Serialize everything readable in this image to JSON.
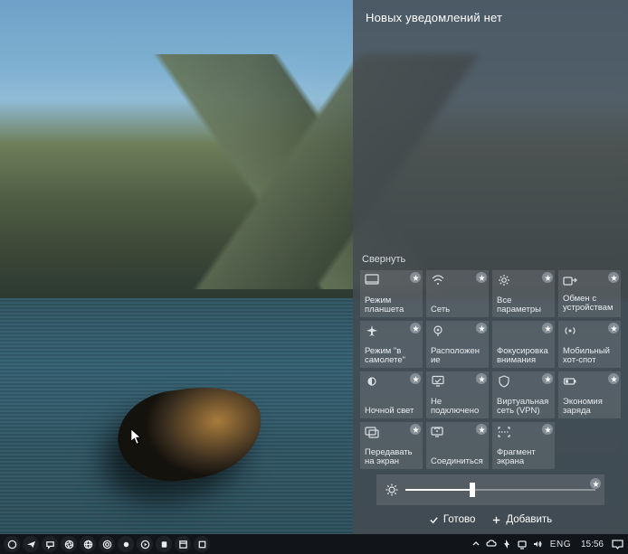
{
  "panel": {
    "title": "Новых уведомлений нет",
    "collapse_label": "Свернуть",
    "tiles": [
      {
        "id": "tablet-mode",
        "label": "Режим планшета",
        "icon": "tablet"
      },
      {
        "id": "network",
        "label": "Сеть",
        "icon": "wifi"
      },
      {
        "id": "settings",
        "label": "Все параметры",
        "icon": "gear"
      },
      {
        "id": "share",
        "label": "Обмен с устройствами",
        "icon": "share"
      },
      {
        "id": "airplane",
        "label": "Режим \"в самолете\"",
        "icon": "airplane"
      },
      {
        "id": "location",
        "label": "Расположение",
        "icon": "location"
      },
      {
        "id": "focus-assist",
        "label": "Фокусировка внимания",
        "icon": "moon"
      },
      {
        "id": "hotspot",
        "label": "Мобильный хот-спот",
        "icon": "hotspot"
      },
      {
        "id": "night-light",
        "label": "Ночной свет",
        "icon": "nightlight"
      },
      {
        "id": "vpn-status",
        "label": "Не подключено",
        "icon": "vpn"
      },
      {
        "id": "vpn",
        "label": "Виртуальная сеть (VPN)",
        "icon": "shield"
      },
      {
        "id": "battery-saver",
        "label": "Экономия заряда",
        "icon": "battery"
      },
      {
        "id": "project",
        "label": "Передавать на экран",
        "icon": "project"
      },
      {
        "id": "connect",
        "label": "Соединиться",
        "icon": "connect"
      },
      {
        "id": "snip",
        "label": "Фрагмент экрана",
        "icon": "snip"
      }
    ],
    "brightness_percent": 35,
    "footer": {
      "done_label": "Готово",
      "add_label": "Добавить"
    }
  },
  "taskbar": {
    "left_icons": [
      "circle",
      "telegram",
      "chat",
      "shutter",
      "globe",
      "ring",
      "dot",
      "play",
      "pandora",
      "window",
      "square"
    ],
    "tray": {
      "chevron": true,
      "icons": [
        "onedrive",
        "power",
        "net",
        "volume"
      ],
      "language": "ENG",
      "time": "15:56"
    }
  }
}
